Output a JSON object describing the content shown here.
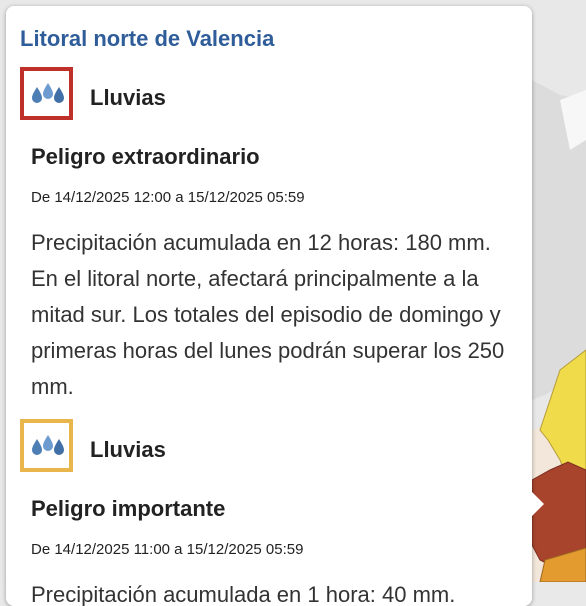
{
  "popup": {
    "region_title": "Litoral norte de Valencia",
    "warnings": [
      {
        "phenomenon": "Lluvias",
        "level": "Peligro extraordinario",
        "level_color": "#c0302b",
        "icon": "rain-drops-icon",
        "dates": "De 14/12/2025 12:00 a 15/12/2025 05:59",
        "description": "Precipitación acumulada en 12 horas: 180 mm. En el litoral norte, afectará principalmente a la mitad sur. Los totales del episodio de domingo y primeras horas del lunes podrán superar los 250 mm."
      },
      {
        "phenomenon": "Lluvias",
        "level": "Peligro importante",
        "level_color": "#e8b64c",
        "icon": "rain-drops-icon",
        "dates": "De 14/12/2025 11:00 a 15/12/2025 05:59",
        "description": "Precipitación acumulada en 1 hora: 40 mm."
      }
    ]
  },
  "map": {
    "colors": {
      "red_zone": "#a8432c",
      "orange_zone": "#e39a2f",
      "yellow_zone": "#f0dc4a",
      "background": "#e9e9e9",
      "coast": "#f3eee4"
    }
  }
}
